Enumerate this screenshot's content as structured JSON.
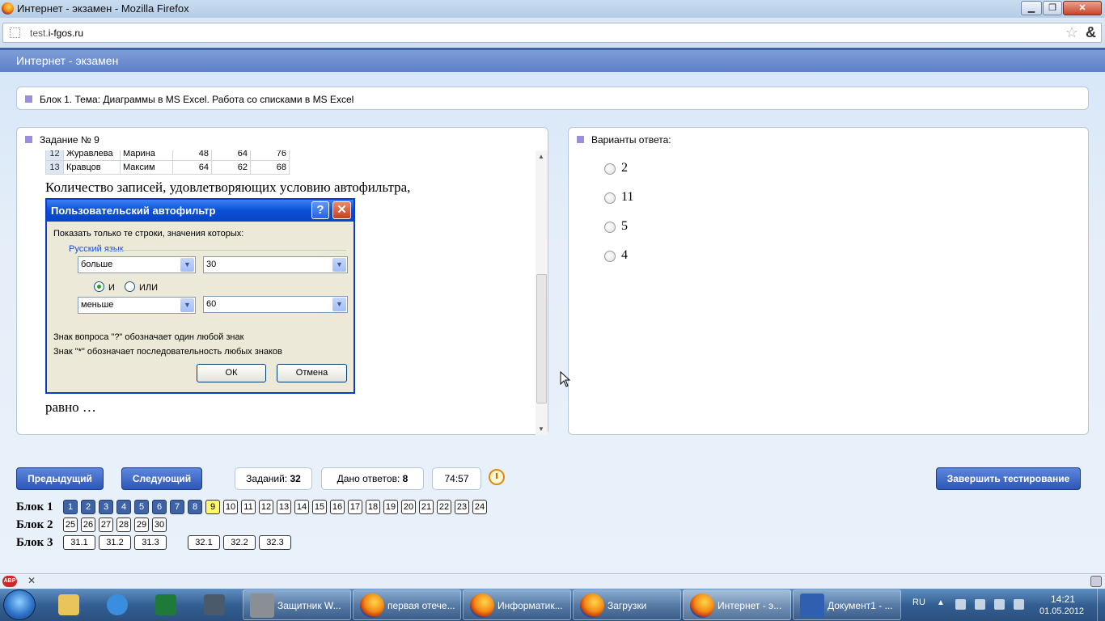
{
  "window": {
    "title": "Интернет - экзамен - Mozilla Firefox",
    "min": "▁",
    "max": "❐",
    "close": "✕"
  },
  "address": {
    "url_host": "test.",
    "url_domain": "i-fgos.ru",
    "star": "☆",
    "amp": "&"
  },
  "app": {
    "title": "Интернет - экзамен"
  },
  "block": {
    "label": "Блок 1. Тема: Диаграммы в MS Excel. Работа со списками в MS Excel"
  },
  "task": {
    "header": "Задание № 9",
    "rows": [
      {
        "num": "12",
        "surname": "Журавлева",
        "name": "Марина",
        "v1": "48",
        "v2": "64",
        "v3": "76"
      },
      {
        "num": "13",
        "surname": "Кравцов",
        "name": "Максим",
        "v1": "64",
        "v2": "62",
        "v3": "68"
      }
    ],
    "question": "Количество записей, удовлетворяющих условию автофильтра,",
    "question_end": "равно …",
    "dialog": {
      "title": "Пользовательский автофильтр",
      "help": "?",
      "close": "✕",
      "show_label": "Показать только те строки, значения которых:",
      "group": "Русский язык",
      "cond1_op": "больше",
      "cond1_val": "30",
      "and_label": "И",
      "or_label": "ИЛИ",
      "cond2_op": "меньше",
      "cond2_val": "60",
      "hint1": "Знак вопроса \"?\" обозначает один любой знак",
      "hint2": "Знак \"*\" обозначает последовательность любых знаков",
      "ok": "ОК",
      "cancel": "Отмена",
      "arrow": "▼"
    }
  },
  "answers": {
    "header": "Варианты ответа:",
    "options": [
      "2",
      "11",
      "5",
      "4"
    ]
  },
  "controls": {
    "prev": "Предыдущий",
    "next": "Следующий",
    "tasks_label": "Заданий:",
    "tasks_count": "32",
    "answers_label": "Дано ответов:",
    "answers_count": "8",
    "timer": "74:57",
    "finish": "Завершить тестирование"
  },
  "nav": {
    "block1_label": "Блок 1",
    "block2_label": "Блок 2",
    "block3_label": "Блок 3",
    "block1": [
      "1",
      "2",
      "3",
      "4",
      "5",
      "6",
      "7",
      "8",
      "9",
      "10",
      "11",
      "12",
      "13",
      "14",
      "15",
      "16",
      "17",
      "18",
      "19",
      "20",
      "21",
      "22",
      "23",
      "24"
    ],
    "block2": [
      "25",
      "26",
      "27",
      "28",
      "29",
      "30"
    ],
    "block3": [
      "31.1",
      "31.2",
      "31.3",
      "32.1",
      "32.2",
      "32.3"
    ],
    "answered_count": 8,
    "current": "9"
  },
  "statusbar": {
    "abp": "ABP",
    "close": "✕"
  },
  "taskbar": {
    "items": [
      "Защитник W...",
      "первая отече...",
      "Информатик...",
      "Загрузки",
      "Интернет - э...",
      "Документ1 - ..."
    ],
    "lang": "RU",
    "tray_arrow": "▲",
    "time": "14:21",
    "date": "01.05.2012"
  }
}
